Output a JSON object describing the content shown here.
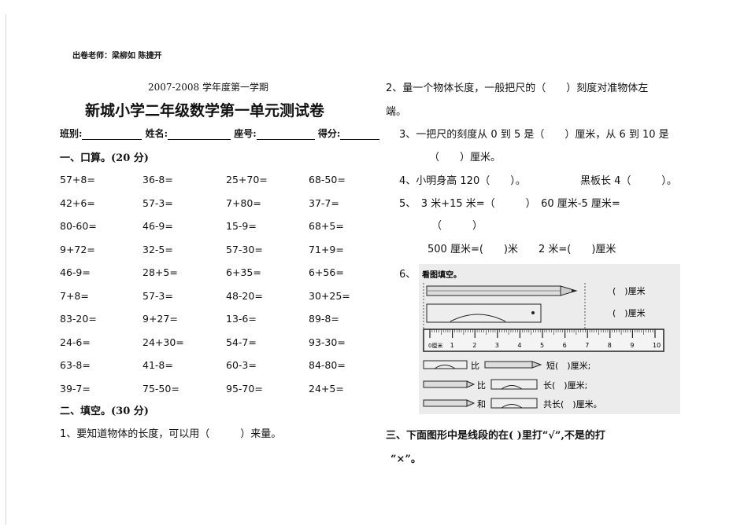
{
  "header": {
    "teacher": "出卷老师：梁柳如 陈捷开",
    "term": "2007-2008 学年度第一学期",
    "title": "新城小学二年级数学第一单元测试卷",
    "fields": [
      "班别:",
      "姓名:",
      "座号:",
      "得分:"
    ]
  },
  "section1": {
    "heading": "一、口算。(20 分)",
    "rows": [
      [
        "57+8=",
        "36-8=",
        "25+70=",
        "68-50="
      ],
      [
        "42+6=",
        "57-3=",
        "7+80=",
        "37-7="
      ],
      [
        "80-60=",
        "46-9=",
        "15-9=",
        "68+5="
      ],
      [
        "9+72=",
        "32-5=",
        "57-30=",
        "71+9="
      ],
      [
        "46-9=",
        "28+5=",
        "6+35=",
        "6+56="
      ],
      [
        "7+8=",
        "57-3=",
        "48-20=",
        "30+25="
      ],
      [
        "83-20=",
        "9+27=",
        "13-6=",
        "89-8="
      ],
      [
        "24-6=",
        "24+30=",
        "54-7=",
        "93-30="
      ],
      [
        "63-8=",
        "41-8=",
        "60-3=",
        "84-80="
      ],
      [
        "39-7=",
        "75-50=",
        "95-70=",
        "24+5="
      ]
    ]
  },
  "section2": {
    "heading": "二、填空。(30 分)",
    "q1": "1、要知道物体的长度，可以用（　　　）来量。",
    "q2a": "2、量一个物体长度，一般把尺的（　　）刻度对准物体左",
    "q2b": "端。",
    "q3a": "3、一把尺的刻度从 0 到 5 是（　　）厘米，从 6 到 10 是",
    "q3b": "（　　）厘米。",
    "q4a": "4、小明身高 120（　　）。",
    "q4b": "黑板长 4（　　　）。",
    "q5a": "5、　3 米+15 米=（　　　）　60 厘米-5 厘米=",
    "q5b": "（　　　）",
    "q5c": "500 厘米=(　　)米　　2 米=(　　)厘米",
    "q6": "6、"
  },
  "figure": {
    "caption": "看图填空。",
    "blank1": "(　)厘米",
    "blank2": "(　)厘米",
    "ruler_unit": "0厘米",
    "ticks": [
      "1",
      "2",
      "3",
      "4",
      "5",
      "6",
      "7",
      "8",
      "9",
      "10"
    ],
    "row1": [
      "比",
      "短(　)厘米;"
    ],
    "row2": [
      "比",
      "长(　)厘米;"
    ],
    "row3": [
      "和",
      "共长(　)厘米。"
    ]
  },
  "section3": {
    "line1": "三、下面图形中是线段的在( )里打“√”,不是的打",
    "line2": "“×”。"
  }
}
